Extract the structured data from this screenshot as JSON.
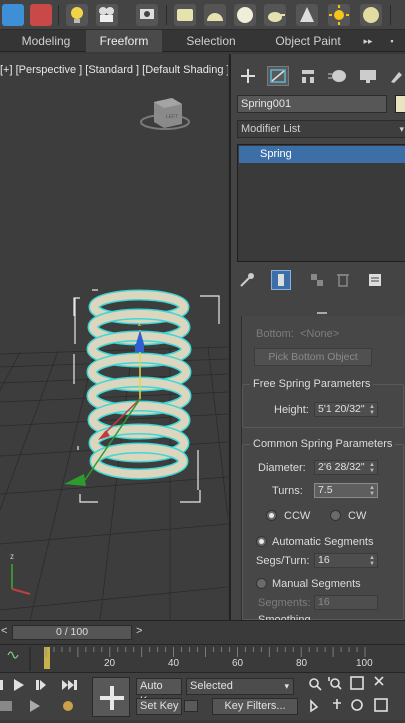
{
  "ribbon": {
    "tabs": [
      {
        "label": "Modeling",
        "active": false
      },
      {
        "label": "Freeform",
        "active": true
      },
      {
        "label": "Selection",
        "active": false
      },
      {
        "label": "Object Paint",
        "active": false
      }
    ],
    "more": "▸▸"
  },
  "viewport": {
    "label": "[+] [Perspective ] [Standard ] [Default Shading ]",
    "viewcube_label": "LEFT"
  },
  "panel": {
    "tab_icons": [
      "create-icon",
      "modify-icon",
      "hierarchy-icon",
      "motion-icon",
      "display-icon",
      "utilities-icon"
    ],
    "object_name": "Spring001",
    "modifier_list": "Modifier List",
    "stack_item": "Spring",
    "bottom_label": "Bottom:",
    "bottom_value": "<None>",
    "pick_bottom": "Pick Bottom Object",
    "free_title": "Free Spring Parameters",
    "height_label": "Height:",
    "height_value": "5'1 20/32\"",
    "common_title": "Common Spring Parameters",
    "diameter_label": "Diameter:",
    "diameter_value": "2'6 28/32\"",
    "turns_label": "Turns:",
    "turns_value": "7.5",
    "ccw": "CCW",
    "cw": "CW",
    "auto_seg": "Automatic Segments",
    "segs_turn_label": "Segs/Turn:",
    "segs_turn_value": "16",
    "manual_seg": "Manual Segments",
    "segments_label": "Segments:",
    "segments_value": "16",
    "smoothing_partial": "Smoothing"
  },
  "timeline": {
    "frame": "0 / 100",
    "ticks": [
      "20",
      "40",
      "60",
      "80",
      "100"
    ]
  },
  "controls": {
    "auto_key": "Auto Key",
    "set_key": "Set Key",
    "selected": "Selected",
    "key_filters": "Key Filters..."
  },
  "colors": {
    "selection": "#3fd6d6",
    "spring": "#ddd6bf",
    "active_blue": "#3c6fa8",
    "swatch": "#e8e3c0"
  }
}
